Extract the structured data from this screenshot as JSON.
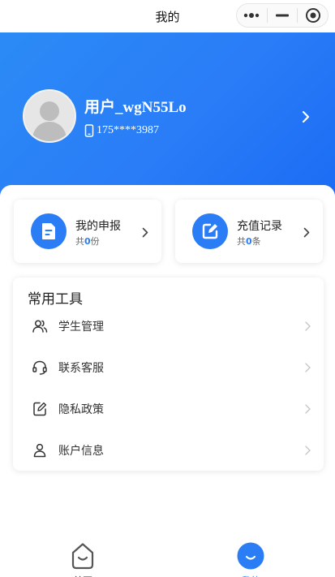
{
  "navbar": {
    "title": "我的"
  },
  "profile": {
    "name": "用户_wgN55Lo",
    "phone": "175****3987"
  },
  "cards": {
    "declare": {
      "title": "我的申报",
      "sub_prefix": "共",
      "count": "0",
      "sub_suffix": "份"
    },
    "recharge": {
      "title": "充值记录",
      "sub_prefix": "共",
      "count": "0",
      "sub_suffix": "条"
    }
  },
  "tools": {
    "title": "常用工具",
    "items": [
      {
        "label": "学生管理",
        "icon": "users-icon"
      },
      {
        "label": "联系客服",
        "icon": "headset-icon"
      },
      {
        "label": "隐私政策",
        "icon": "edit-doc-icon"
      },
      {
        "label": "账户信息",
        "icon": "user-icon"
      }
    ]
  },
  "tabbar": {
    "items": [
      {
        "label": "首页",
        "icon": "home-icon",
        "active": false
      },
      {
        "label": "我的",
        "icon": "profile-smile-icon",
        "active": true
      }
    ]
  },
  "colors": {
    "accent": "#2b7df5",
    "header_start": "#2b8bf5",
    "header_end": "#1b6cf4"
  }
}
